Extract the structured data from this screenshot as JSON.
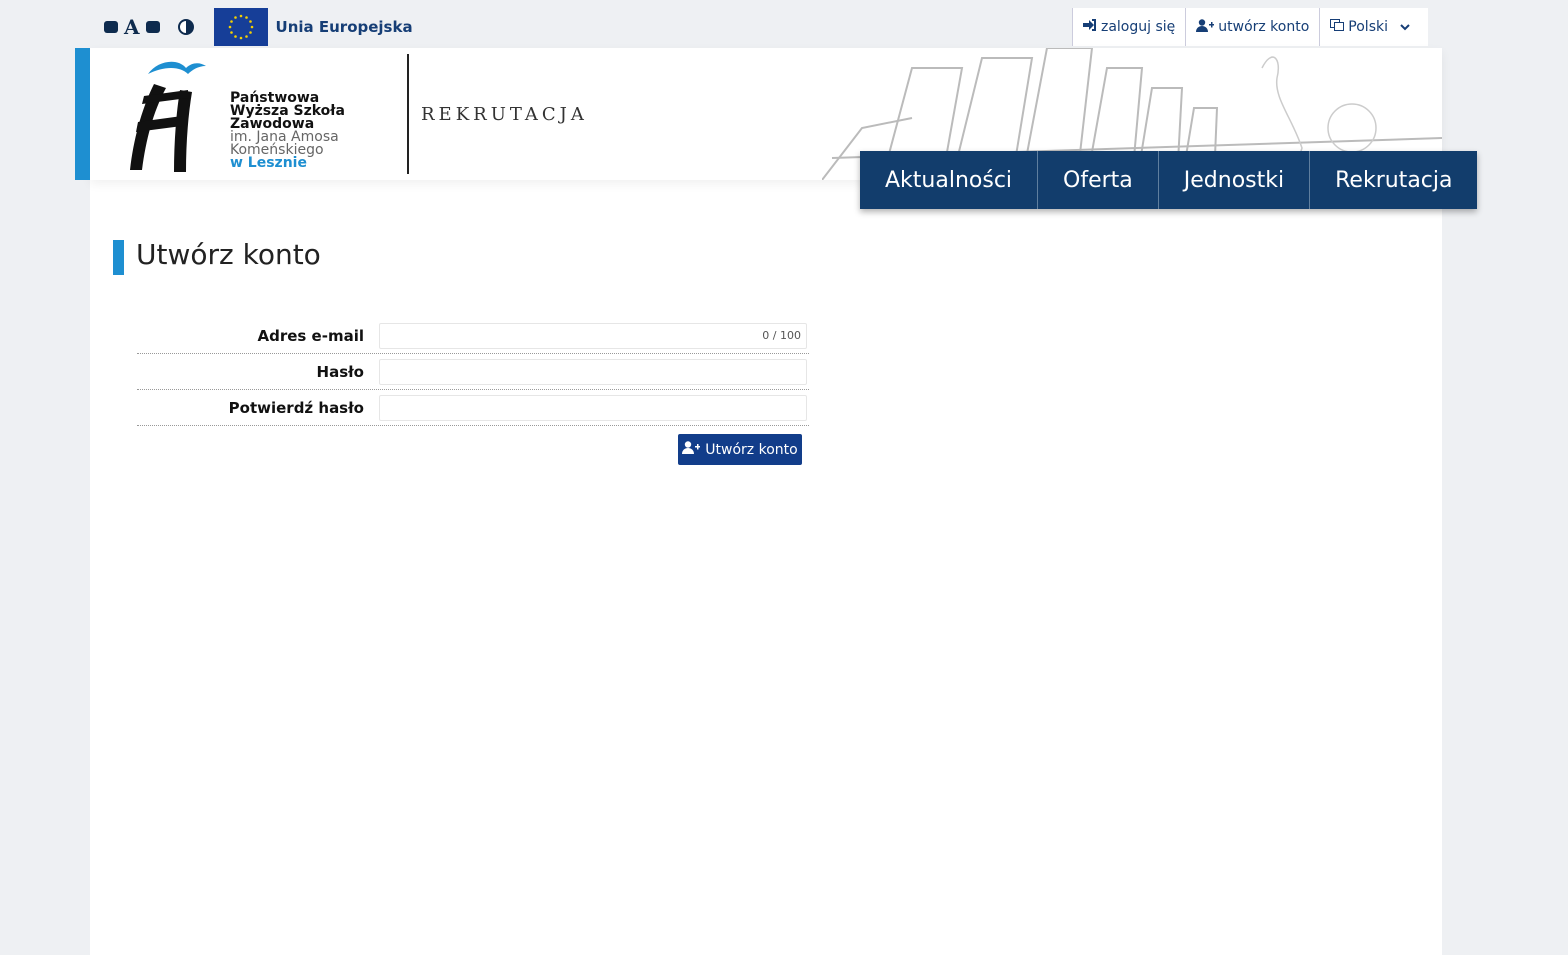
{
  "topbar": {
    "font_decrease": "−",
    "font_reset": "A",
    "font_increase": "+",
    "eu_label": "Unia Europejska",
    "login_label": "zaloguj się",
    "create_account_label": "utwórz konto",
    "language_label": "Polski"
  },
  "header": {
    "logo_lines": [
      "Państwowa",
      "Wyższa Szkoła",
      "Zawodowa",
      "im. Jana Amosa",
      "Komeńskiego",
      "w Lesznie"
    ],
    "section_title": "REKRUTACJA"
  },
  "nav": {
    "items": [
      "Aktualności",
      "Oferta",
      "Jednostki",
      "Rekrutacja"
    ]
  },
  "main": {
    "title": "Utwórz konto",
    "form": {
      "email_label": "Adres e-mail",
      "email_counter": "0 / 100",
      "password_label": "Hasło",
      "confirm_label": "Potwierdź hasło",
      "submit_label": "Utwórz konto"
    }
  },
  "colors": {
    "accent_blue": "#1e8fd1",
    "nav_navy": "#123d6c",
    "button_navy": "#123d8a"
  }
}
